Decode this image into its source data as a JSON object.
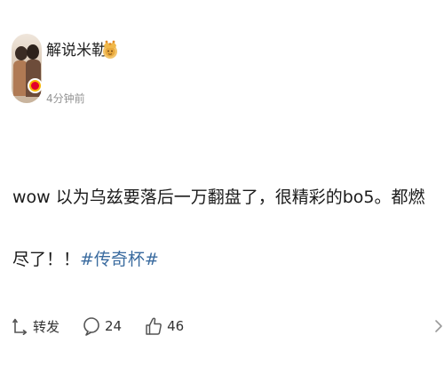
{
  "post": {
    "author": {
      "name": "解说米勒",
      "avatar": "avatar",
      "verified_icon": "verified-v-icon",
      "badge_icon": "crown-icon"
    },
    "time": "4分钟前",
    "content": {
      "text": "wow 以为乌兹要落后一万翻盘了，很精彩的bo5。都燃尽了！！",
      "topic": "#传奇杯#"
    },
    "actions": {
      "repost": {
        "icon": "repost-icon",
        "label": "转发"
      },
      "comment": {
        "icon": "comment-icon",
        "count": "24"
      },
      "like": {
        "icon": "thumbs-up-icon",
        "count": "46"
      }
    }
  },
  "colors": {
    "topic": "#3a6b9f",
    "text": "#1a1a1a",
    "muted": "#939393",
    "verified": "#f7b500"
  }
}
